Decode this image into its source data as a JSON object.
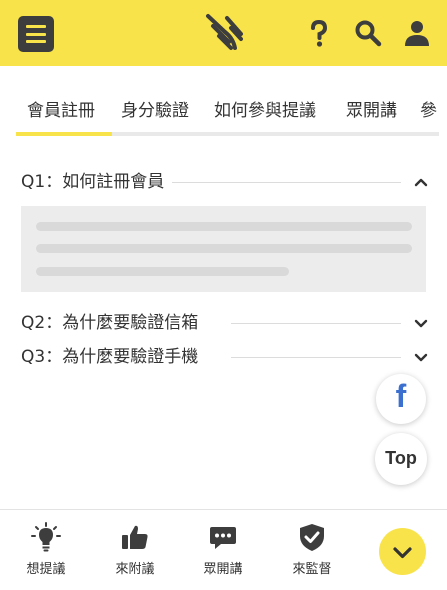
{
  "colors": {
    "brand_yellow": "#f9e34a",
    "dark": "#3d3d3d",
    "facebook_blue": "#3b6fd0"
  },
  "header": {
    "menu_icon": "hamburger-menu-icon",
    "logo": "hand-wave-logo",
    "icons": [
      "question-icon",
      "search-icon",
      "user-icon"
    ]
  },
  "tabs": [
    {
      "label": "會員註冊",
      "active": true
    },
    {
      "label": "身分驗證",
      "active": false
    },
    {
      "label": "如何參與提議",
      "active": false
    },
    {
      "label": "眾開講",
      "active": false
    },
    {
      "label": "參",
      "active": false
    }
  ],
  "faq": [
    {
      "question": "Q1：如何註冊會員",
      "expanded": true
    },
    {
      "question": "Q2：為什麼要驗證信箱",
      "expanded": false
    },
    {
      "question": "Q3：為什麼要驗證手機",
      "expanded": false
    }
  ],
  "floating": {
    "facebook_glyph": "f",
    "top_label": "Top"
  },
  "bottom_nav": [
    {
      "label": "想提議",
      "icon": "lightbulb-icon"
    },
    {
      "label": "來附議",
      "icon": "thumbs-up-icon"
    },
    {
      "label": "眾開講",
      "icon": "chat-bubble-icon"
    },
    {
      "label": "來監督",
      "icon": "shield-check-icon"
    }
  ]
}
